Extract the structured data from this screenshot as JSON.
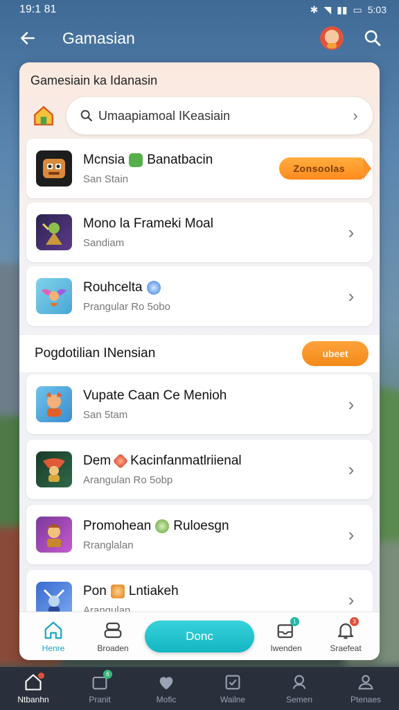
{
  "status_bar": {
    "time": "19:1 81",
    "right_time": "5:03"
  },
  "app_bar": {
    "title": "Gamasian"
  },
  "panel": {
    "heading": "Gamesiain ka Idanasin",
    "search_text": "Umaapiamoal IKeasiain"
  },
  "featured": [
    {
      "title": "Mcnsia",
      "title2": "Banatbacin",
      "subtitle": "San Stain",
      "badge": "Zonsoolas",
      "icon": "robot-game-icon",
      "mini_icon": "shield-green-icon"
    },
    {
      "title": "Mono la Frameki Moal",
      "subtitle": "Sandiam",
      "icon": "warrior-game-icon"
    },
    {
      "title": "Rouhcelta",
      "subtitle": "Prangular Ro 5obo",
      "icon": "fairy-game-icon",
      "mini_icon": "blue-gem-icon"
    }
  ],
  "section": {
    "title": "Pogdotilian INensian",
    "more_label": "ubeet"
  },
  "list": [
    {
      "title": "Vupate Caan Ce Menioh",
      "subtitle": "San 5tam",
      "icon": "fox-hero-icon"
    },
    {
      "title": "Dem",
      "title2": "Kacinfanmatlriienal",
      "subtitle": "Arangulan Ro 5obp",
      "icon": "dragon-warrior-icon",
      "mini_icon": "red-gem-icon"
    },
    {
      "title": "Promohean",
      "title2": "Ruloesgn",
      "subtitle": "Rranglalan",
      "icon": "knight-hero-icon",
      "mini_icon": "green-gem-icon"
    },
    {
      "title": "Pon",
      "title2": "Lntiakeh",
      "subtitle": "Arangulan",
      "icon": "wizard-hero-icon",
      "mini_icon": "orange-gem-icon"
    }
  ],
  "inner_tabs": [
    {
      "label": "Henre",
      "icon": "home-icon",
      "active": true
    },
    {
      "label": "Broaden",
      "icon": "controller-icon"
    },
    {
      "label": "Iwenden",
      "icon": "inbox-icon",
      "badge": "1"
    },
    {
      "label": "Sraefeat",
      "icon": "bell-icon",
      "badge": "3"
    }
  ],
  "done_label": "Donc",
  "sys_nav": [
    {
      "label": "Ntbanhn",
      "icon": "home-outline-icon",
      "active": true
    },
    {
      "label": "Pranit",
      "icon": "gift-icon",
      "badge": "6"
    },
    {
      "label": "Mofic",
      "icon": "heart-icon"
    },
    {
      "label": "Wailne",
      "icon": "checkbox-icon"
    },
    {
      "label": "Semen",
      "icon": "headset-icon"
    },
    {
      "label": "Ptenaes",
      "icon": "profile-icon"
    }
  ],
  "colors": {
    "accent_teal": "#13b6c2",
    "accent_orange": "#ff8a1e"
  }
}
